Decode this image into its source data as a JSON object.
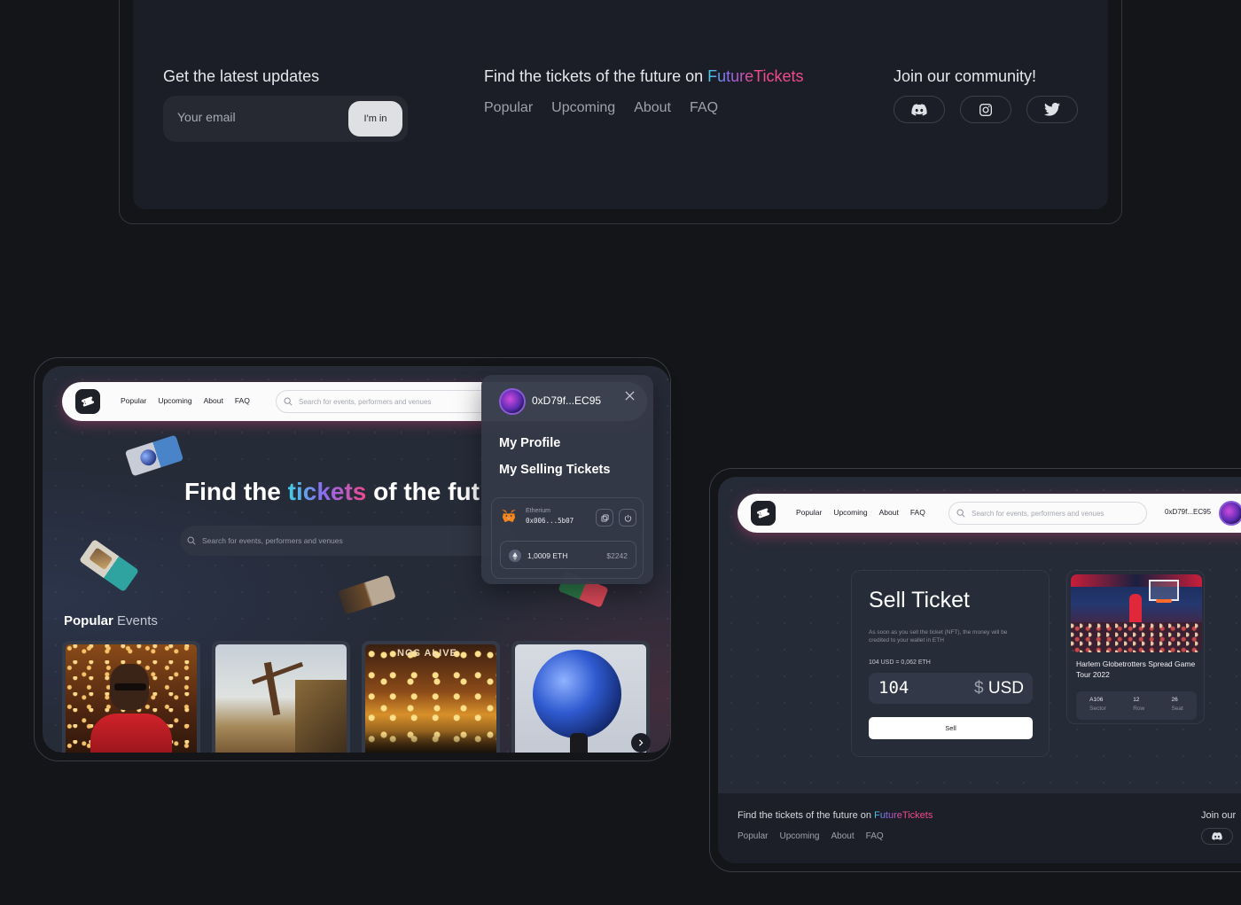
{
  "footer_top": {
    "updates_heading": "Get the latest updates",
    "email_placeholder": "Your email",
    "subscribe_label": "I'm in",
    "tagline_prefix": "Find the tickets of the future on ",
    "brand_future": "Future",
    "brand_tickets": "Tickets",
    "nav": [
      "Popular",
      "Upcoming",
      "About",
      "FAQ"
    ],
    "community_heading": "Join our community!",
    "social_icons": [
      "discord-icon",
      "instagram-icon",
      "twitter-icon"
    ]
  },
  "left_screen": {
    "nav": [
      "Popular",
      "Upcoming",
      "About",
      "FAQ"
    ],
    "search_placeholder": "Search for events, performers and  venues",
    "hero_prefix": "Find the ",
    "hero_highlight": "tickets",
    "hero_suffix": " of the fut",
    "hero_search_placeholder": "Search for events, performers and  venues",
    "popular_strong": "Popular",
    "popular_rest": " Events",
    "card3_overlay": "NOS ALIVE"
  },
  "wallet_menu": {
    "address": "0xD79f...EC95",
    "items": [
      "My Profile",
      "My Selling Tickets"
    ],
    "network": "Etherium",
    "wallet_hash": "0x006...5b07",
    "eth_balance": "1,0009 ETH",
    "usd_balance": "$2242"
  },
  "right_screen": {
    "nav": [
      "Popular",
      "Upcoming",
      "About",
      "FAQ"
    ],
    "search_placeholder": "Search for events, performers and  venues",
    "address": "0xD79f...EC95",
    "sell_title": "Sell Ticket",
    "sell_desc": "As soon as you sell the ticket (NFT), the money will be credited to your wallet in ETH",
    "rate": "104 USD = 0,062 ETH",
    "amount": "104",
    "currency_symbol": "$",
    "currency": "USD",
    "sell_button": "Sell",
    "ticket_title": "Harlem Globetrotters Spread Game Tour 2022",
    "sector_value": "A106",
    "sector_label": "Sector",
    "row_value": "12",
    "row_label": "Row",
    "seat_value": "26",
    "seat_label": "Seat",
    "footer_prefix": "Find the tickets of the future on ",
    "footer_brand_future": "Future",
    "footer_brand_tickets": "Tickets",
    "footer_nav": [
      "Popular",
      "Upcoming",
      "About",
      "FAQ"
    ],
    "join_heading": "Join our"
  },
  "colors": {
    "background": "#141519",
    "panel": "#1b1e26",
    "accent_cyan": "#3fd0e6",
    "accent_pink": "#ef4a8e"
  }
}
